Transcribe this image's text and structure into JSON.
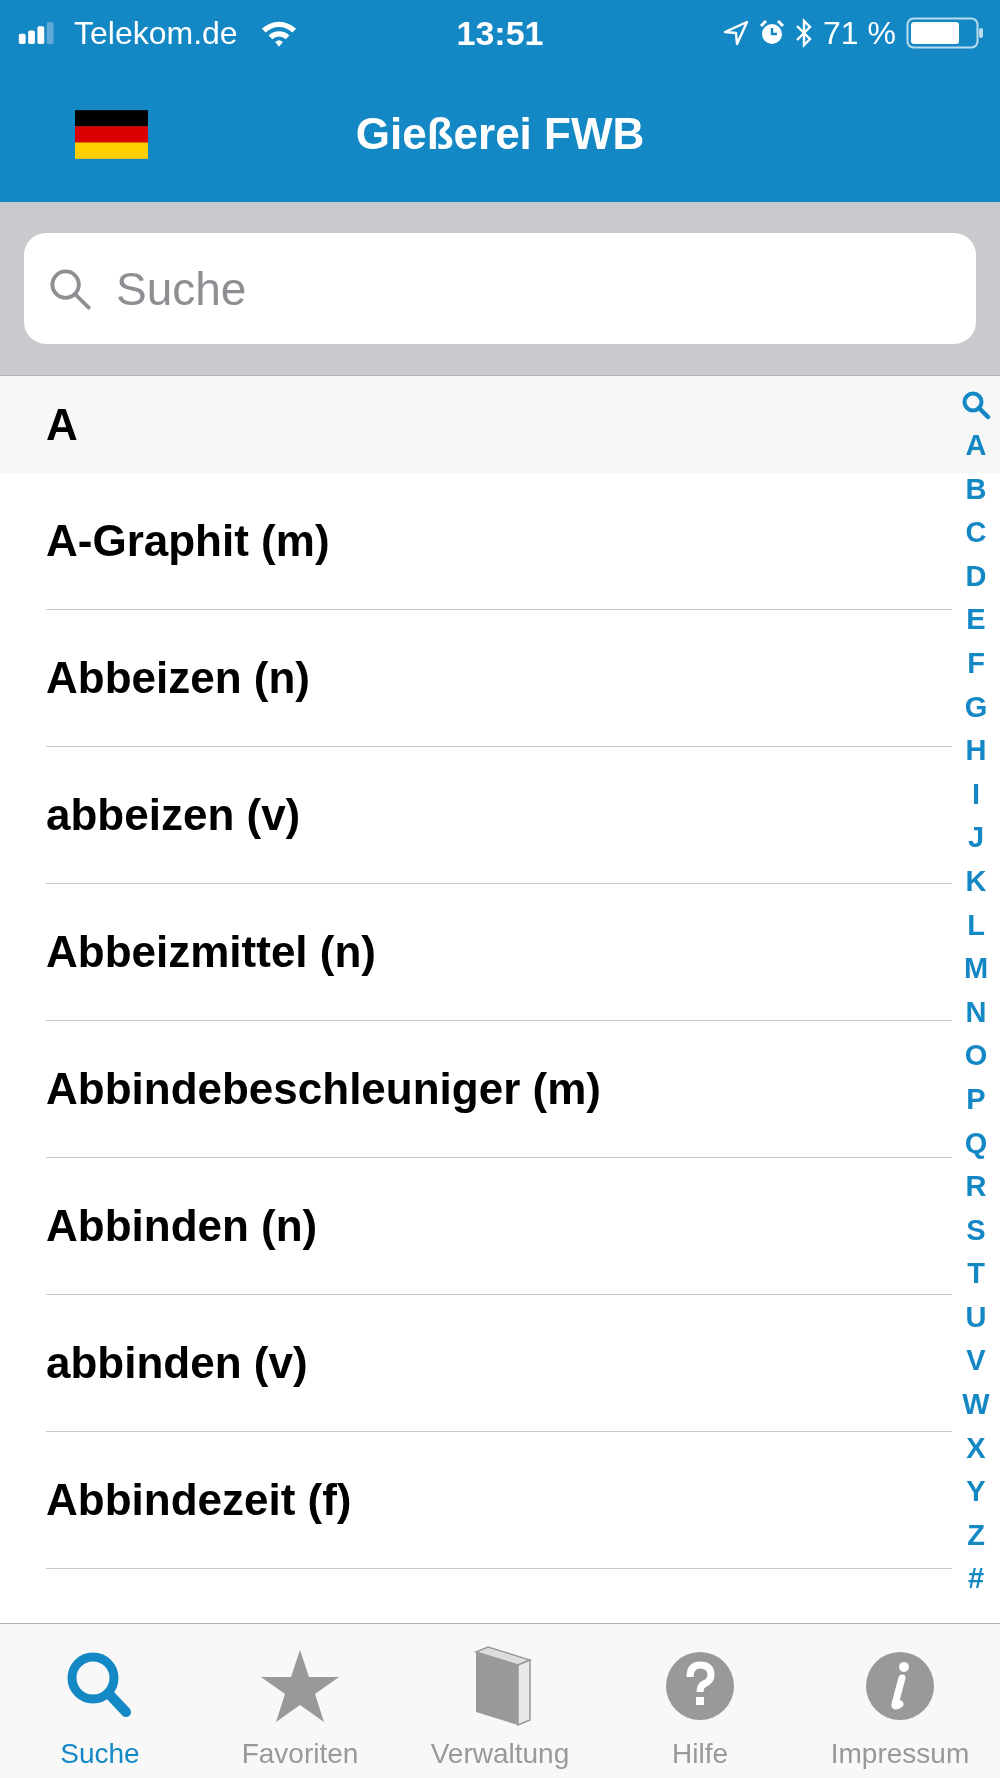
{
  "status_bar": {
    "carrier": "Telekom.de",
    "time": "13:51",
    "battery": "71 %"
  },
  "nav_bar": {
    "title": "Gießerei FWB"
  },
  "search": {
    "placeholder": "Suche"
  },
  "section": {
    "header": "A"
  },
  "entries": [
    "A-Graphit (m)",
    "Abbeizen (n)",
    "abbeizen (v)",
    "Abbeizmittel (n)",
    "Abbindebeschleuniger (m)",
    "Abbinden (n)",
    "abbinden (v)",
    "Abbindezeit (f)"
  ],
  "index": [
    "A",
    "B",
    "C",
    "D",
    "E",
    "F",
    "G",
    "H",
    "I",
    "J",
    "K",
    "L",
    "M",
    "N",
    "O",
    "P",
    "Q",
    "R",
    "S",
    "T",
    "U",
    "V",
    "W",
    "X",
    "Y",
    "Z",
    "#"
  ],
  "tabs": [
    {
      "label": "Suche",
      "kind": "search",
      "selected": true
    },
    {
      "label": "Favoriten",
      "kind": "star",
      "selected": false
    },
    {
      "label": "Verwaltung",
      "kind": "book",
      "selected": false
    },
    {
      "label": "Hilfe",
      "kind": "help",
      "selected": false
    },
    {
      "label": "Impressum",
      "kind": "info",
      "selected": false
    }
  ]
}
